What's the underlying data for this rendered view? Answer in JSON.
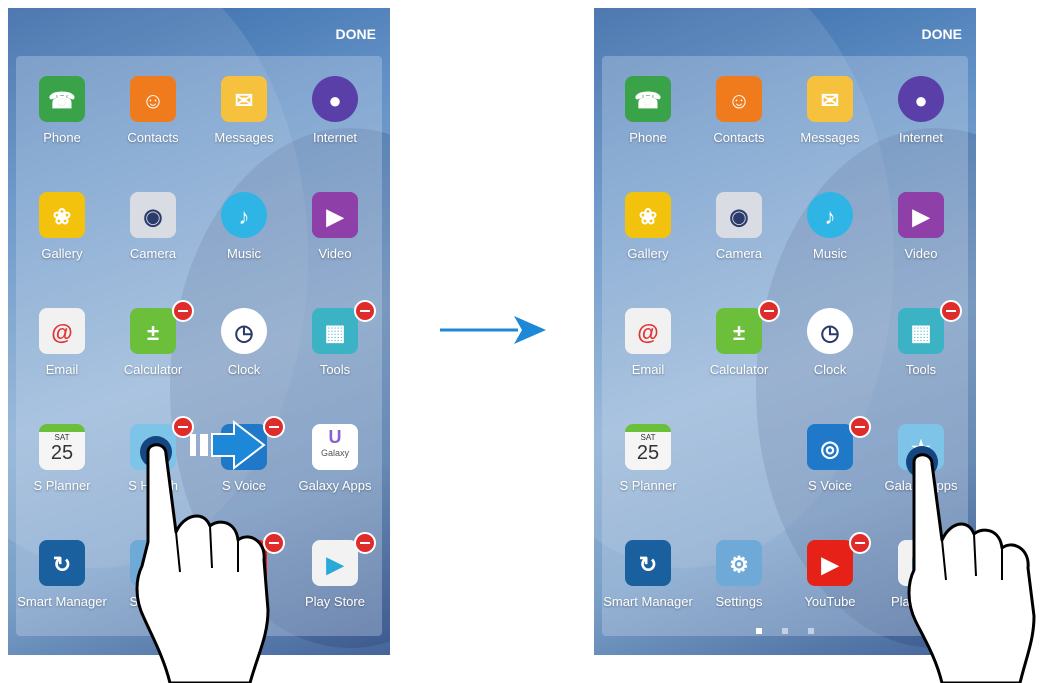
{
  "left_screen": {
    "done_label": "DONE",
    "apps": [
      {
        "label": "Phone",
        "icon": "phone-icon",
        "color": "#3aa34a",
        "removable": false
      },
      {
        "label": "Contacts",
        "icon": "contacts-icon",
        "color": "#f07b1d",
        "removable": false
      },
      {
        "label": "Messages",
        "icon": "messages-icon",
        "color": "#f6c23e",
        "removable": false
      },
      {
        "label": "Internet",
        "icon": "internet-icon",
        "color": "#5a3fa8",
        "removable": false
      },
      {
        "label": "Gallery",
        "icon": "gallery-icon",
        "color": "#f2c20d",
        "removable": false
      },
      {
        "label": "Camera",
        "icon": "camera-icon",
        "color": "#d9dde3",
        "removable": false
      },
      {
        "label": "Music",
        "icon": "music-icon",
        "color": "#2fb4e6",
        "removable": false
      },
      {
        "label": "Video",
        "icon": "video-icon",
        "color": "#8e3fa8",
        "removable": false
      },
      {
        "label": "Email",
        "icon": "email-icon",
        "color": "#f1f1f1",
        "removable": false
      },
      {
        "label": "Calculator",
        "icon": "calculator-icon",
        "color": "#6bbf3b",
        "removable": true
      },
      {
        "label": "Clock",
        "icon": "clock-icon",
        "color": "#ffffff",
        "removable": false
      },
      {
        "label": "Tools",
        "icon": "tools-icon",
        "color": "#3bb3c4",
        "removable": true
      },
      {
        "label": "S Planner",
        "icon": "s-planner-icon",
        "color": "#f5f5f5",
        "removable": false
      },
      {
        "label": "S Health",
        "icon": "s-health-icon",
        "color": "#7ec4e8",
        "removable": true
      },
      {
        "label": "S Voice",
        "icon": "s-voice-icon",
        "color": "#1f78c8",
        "removable": true
      },
      {
        "label": "Galaxy Apps",
        "icon": "galaxy-apps-icon",
        "color": "#ffffff",
        "removable": false
      },
      {
        "label": "Smart Manager",
        "icon": "smart-manager-icon",
        "color": "#1a5f9e",
        "removable": false
      },
      {
        "label": "Settings",
        "icon": "settings-icon",
        "color": "#6fa9d8",
        "removable": false
      },
      {
        "label": "YouTube",
        "icon": "youtube-icon",
        "color": "#e62117",
        "removable": true
      },
      {
        "label": "Play Store",
        "icon": "play-store-icon",
        "color": "#f2f2f2",
        "removable": true
      }
    ]
  },
  "right_screen": {
    "done_label": "DONE",
    "apps": [
      {
        "label": "Phone",
        "icon": "phone-icon",
        "color": "#3aa34a",
        "removable": false
      },
      {
        "label": "Contacts",
        "icon": "contacts-icon",
        "color": "#f07b1d",
        "removable": false
      },
      {
        "label": "Messages",
        "icon": "messages-icon",
        "color": "#f6c23e",
        "removable": false
      },
      {
        "label": "Internet",
        "icon": "internet-icon",
        "color": "#5a3fa8",
        "removable": false
      },
      {
        "label": "Gallery",
        "icon": "gallery-icon",
        "color": "#f2c20d",
        "removable": false
      },
      {
        "label": "Camera",
        "icon": "camera-icon",
        "color": "#d9dde3",
        "removable": false
      },
      {
        "label": "Music",
        "icon": "music-icon",
        "color": "#2fb4e6",
        "removable": false
      },
      {
        "label": "Video",
        "icon": "video-icon",
        "color": "#8e3fa8",
        "removable": false
      },
      {
        "label": "Email",
        "icon": "email-icon",
        "color": "#f1f1f1",
        "removable": false
      },
      {
        "label": "Calculator",
        "icon": "calculator-icon",
        "color": "#6bbf3b",
        "removable": true
      },
      {
        "label": "Clock",
        "icon": "clock-icon",
        "color": "#ffffff",
        "removable": false
      },
      {
        "label": "Tools",
        "icon": "tools-icon",
        "color": "#3bb3c4",
        "removable": true
      },
      {
        "label": "S Planner",
        "icon": "s-planner-icon",
        "color": "#f5f5f5",
        "removable": false
      },
      {
        "label": "",
        "icon": "",
        "color": "",
        "removable": false
      },
      {
        "label": "S Voice",
        "icon": "s-voice-icon",
        "color": "#1f78c8",
        "removable": true
      },
      {
        "label": "Galaxy Apps",
        "icon": "s-health-icon",
        "color": "#7ec4e8",
        "removable": false
      },
      {
        "label": "Smart Manager",
        "icon": "smart-manager-icon",
        "color": "#1a5f9e",
        "removable": false
      },
      {
        "label": "Settings",
        "icon": "settings-icon",
        "color": "#6fa9d8",
        "removable": false
      },
      {
        "label": "YouTube",
        "icon": "youtube-icon",
        "color": "#e62117",
        "removable": true
      },
      {
        "label": "Play Store",
        "icon": "play-store-icon",
        "color": "#f2f2f2",
        "removable": false
      }
    ],
    "page_dots": 3,
    "active_dot": 0
  },
  "s_planner": {
    "day": "SAT",
    "date": "25"
  },
  "galaxy_apps_text": "Galaxy",
  "accent": "#1e88d8"
}
